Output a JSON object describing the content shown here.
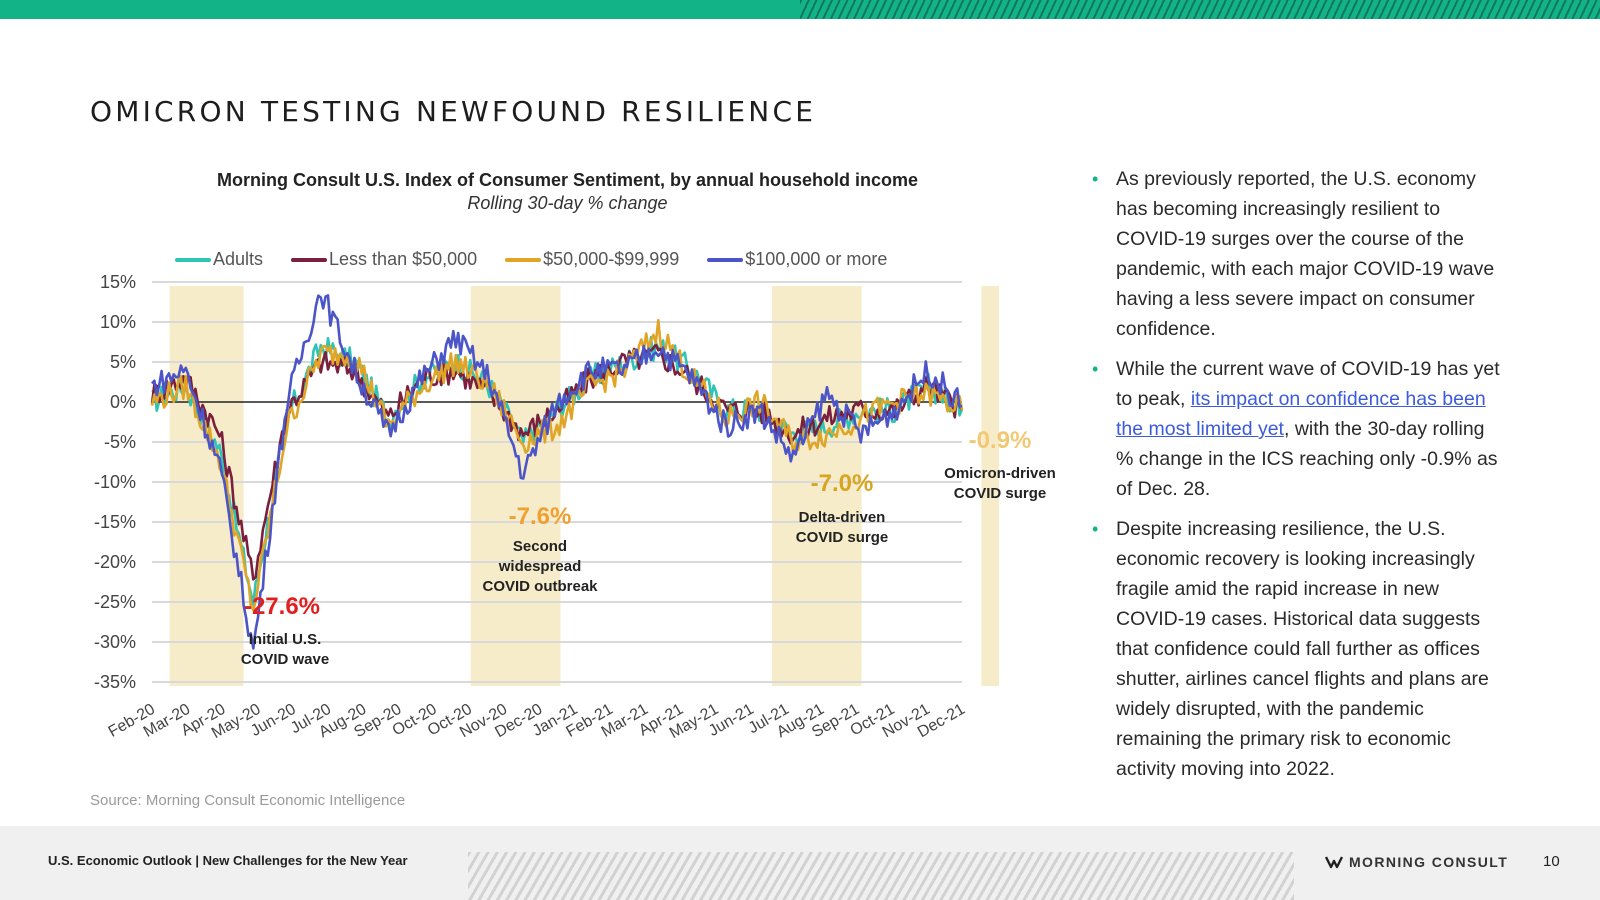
{
  "page": {
    "title": "OMICRON TESTING NEWFOUND RESILIENCE",
    "source": "Source: Morning Consult Economic Intelligence"
  },
  "chart_data": {
    "type": "line",
    "title": "Morning Consult U.S. Index of Consumer Sentiment, by annual household income",
    "subtitle": "Rolling 30-day % change",
    "xlabel": "",
    "ylabel": "",
    "x": [
      "Feb-20",
      "Mar-20",
      "Apr-20",
      "May-20",
      "Jun-20",
      "Jul-20",
      "Aug-20",
      "Sep-20",
      "Oct-20",
      "Oct-20",
      "Nov-20",
      "Dec-20",
      "Jan-21",
      "Feb-21",
      "Mar-21",
      "Apr-21",
      "May-21",
      "Jun-21",
      "Jul-21",
      "Aug-21",
      "Sep-21",
      "Oct-21",
      "Nov-21",
      "Dec-21"
    ],
    "y_ticks": [
      "15%",
      "10%",
      "5%",
      "0%",
      "-5%",
      "-10%",
      "-15%",
      "-20%",
      "-25%",
      "-30%",
      "-35%"
    ],
    "ylim": [
      -35,
      15
    ],
    "grid": true,
    "legend_position": "top",
    "series": [
      {
        "name": "Adults",
        "color": "#2ec4b6",
        "values": [
          0,
          2,
          -6,
          -25,
          -2,
          7,
          5,
          -2,
          3,
          5,
          2,
          -5,
          -1,
          3,
          5,
          7,
          4,
          -1,
          -1,
          -4,
          -3,
          -1,
          -1,
          2,
          -0.9
        ]
      },
      {
        "name": "Less than $50,000",
        "color": "#7a1f3d",
        "values": [
          1,
          3,
          -4,
          -22,
          -1,
          5,
          4,
          -2,
          3,
          4,
          1,
          -4,
          -1,
          3,
          5,
          6,
          3,
          -1,
          -1,
          -4,
          -2,
          -1,
          -1,
          2,
          -1
        ]
      },
      {
        "name": "$50,000-$99,999",
        "color": "#e0a526",
        "values": [
          0,
          2,
          -7,
          -26,
          -3,
          6,
          6,
          -3,
          2,
          5,
          2,
          -5,
          -3,
          2,
          4,
          9,
          3,
          -2,
          0,
          -5,
          -4,
          -2,
          0,
          1,
          -1
        ]
      },
      {
        "name": "$100,000 or more",
        "color": "#4b55c8",
        "values": [
          2,
          4,
          -8,
          -31,
          0,
          14,
          4,
          -4,
          3,
          8,
          3,
          -9,
          0,
          4,
          4,
          7,
          3,
          -3,
          -1,
          -7,
          1,
          -4,
          -1,
          4,
          -0.5
        ]
      }
    ],
    "shaded_periods": [
      "Initial U.S. COVID wave",
      "Second widespread COVID outbreak",
      "Delta-driven COVID surge",
      "Omicron-driven COVID surge"
    ],
    "annotations": [
      {
        "value": "-27.6%",
        "label_lines": [
          "Initial U.S.",
          "COVID wave"
        ],
        "color": "#e02020"
      },
      {
        "value": "-7.6%",
        "label_lines": [
          "Second",
          "widespread",
          "COVID outbreak"
        ],
        "color": "#f0a030"
      },
      {
        "value": "-7.0%",
        "label_lines": [
          "Delta-driven",
          "COVID surge"
        ],
        "color": "#d9a520"
      },
      {
        "value": "-0.9%",
        "label_lines": [
          "Omicron-driven",
          "COVID surge"
        ],
        "color": "#f3c873"
      }
    ]
  },
  "bullets": [
    {
      "text": "As previously reported, the U.S. economy has becoming increasingly resilient to COVID-19 surges over the course of the pandemic, with each major COVID-19 wave having a less severe impact on consumer confidence."
    },
    {
      "pre": "While the current wave of COVID-19 has yet to peak, ",
      "link": "its impact on confidence has been the most limited yet",
      "post": ", with the 30-day rolling % change in the ICS reaching only -0.9% as of Dec. 28."
    },
    {
      "text": "Despite increasing resilience, the U.S. economic recovery is looking increasingly fragile amid the rapid increase in new COVID-19 cases. Historical data suggests that confidence could fall further as offices shutter, airlines cancel flights and plans are widely disrupted, with the pandemic remaining the primary risk to economic activity moving into 2022."
    }
  ],
  "footer": {
    "text": "U.S. Economic Outlook | New Challenges for the New Year",
    "logo": "MORNING CONSULT",
    "page_number": "10"
  },
  "colors": {
    "brand_green": "#12b386",
    "shade": "#f7ecc9"
  }
}
